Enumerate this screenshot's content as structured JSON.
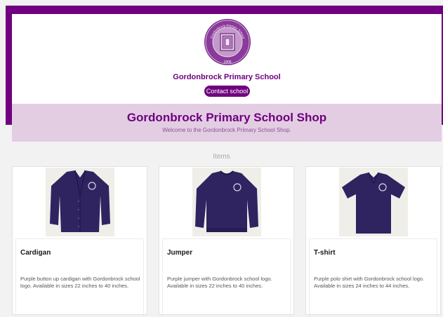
{
  "header": {
    "logo_text_top": "Gordonbrock Primary School",
    "logo_year": "1905",
    "school_name": "Gordonbrock Primary School",
    "contact_label": "Contact school"
  },
  "shop": {
    "title": "Gordonbrock Primary School Shop",
    "welcome": "Welcome to the Gordonbrock Primary School Shop."
  },
  "items_heading": "Items",
  "items": [
    {
      "name": "Cardigan",
      "description": "Purple button up cardigan with Gordonbrock school logo. Available in sizes 22 inches to 40 inches.",
      "image_icon": "cardigan-image"
    },
    {
      "name": "Jumper",
      "description": "Purple jumper with Gordonbrock school logo. Available in sizes 22 inches to 40 inches.",
      "image_icon": "jumper-image"
    },
    {
      "name": "T-shirt",
      "description": "Purple polo shirt with Gordonbrock school logo. Available in sizes 24 inches to 44 inches.",
      "image_icon": "t-shirt-image"
    }
  ],
  "colors": {
    "brand_purple": "#700080",
    "banner_lilac": "#e2cde3",
    "garment_navy": "#2f2460"
  }
}
